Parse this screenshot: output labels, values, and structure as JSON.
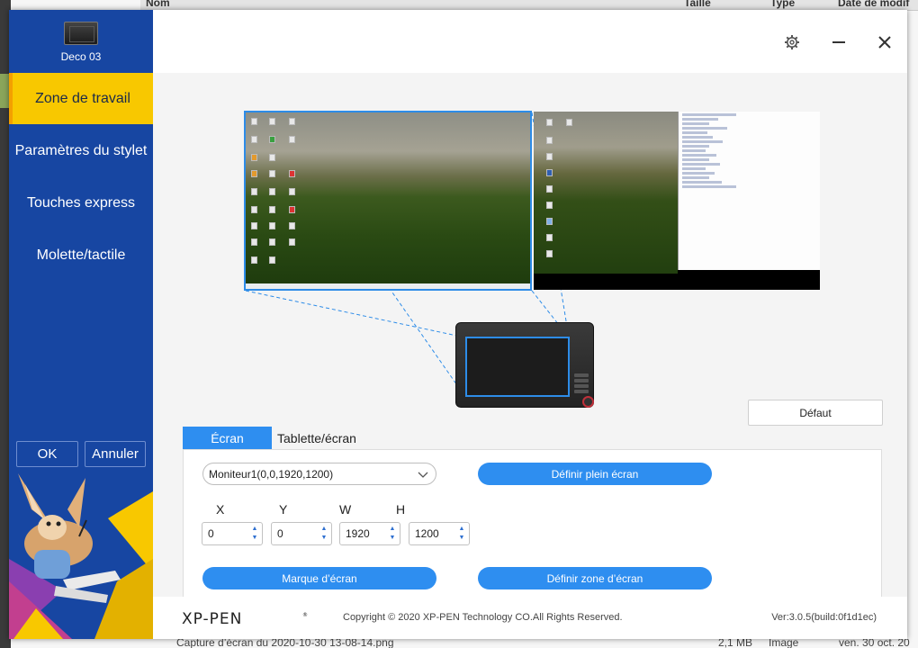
{
  "background_fm": {
    "columns": [
      "Nom",
      "Taille",
      "Type",
      "Date de modif"
    ],
    "bottom_row": {
      "name": "Capture d’écran du 2020-10-30 13-08-14.png",
      "size": "2,1 MB",
      "type": "Image",
      "date": "ven. 30 oct. 20"
    }
  },
  "app": {
    "device_name": "Deco 03",
    "nav": [
      "Zone de travail",
      "Paramètres du stylet",
      "Touches express",
      "Molette/tactile"
    ],
    "ok_label": "OK",
    "cancel_label": "Annuler",
    "default_label": "Défaut",
    "tabs": [
      "Écran",
      "Tablette/écran"
    ],
    "monitor_select": "Moniteur1(0,0,1920,1200)",
    "full_screen_label": "Définir plein écran",
    "screen_mark_label": "Marque d’écran",
    "set_area_label": "Définir zone d’écran",
    "coords": [
      {
        "label": "X",
        "value": "0"
      },
      {
        "label": "Y",
        "value": "0"
      },
      {
        "label": "W",
        "value": "1920"
      },
      {
        "label": "H",
        "value": "1200"
      }
    ],
    "brand": "XP-PEN",
    "copyright": "Copyright © 2020 XP-PEN Technology CO.All Rights Reserved.",
    "version": "Ver:3.0.5(build:0f1d1ec)"
  },
  "colors": {
    "sidebar": "#1746a2",
    "accent": "#2e8ef0",
    "active_nav": "#f8c800"
  }
}
